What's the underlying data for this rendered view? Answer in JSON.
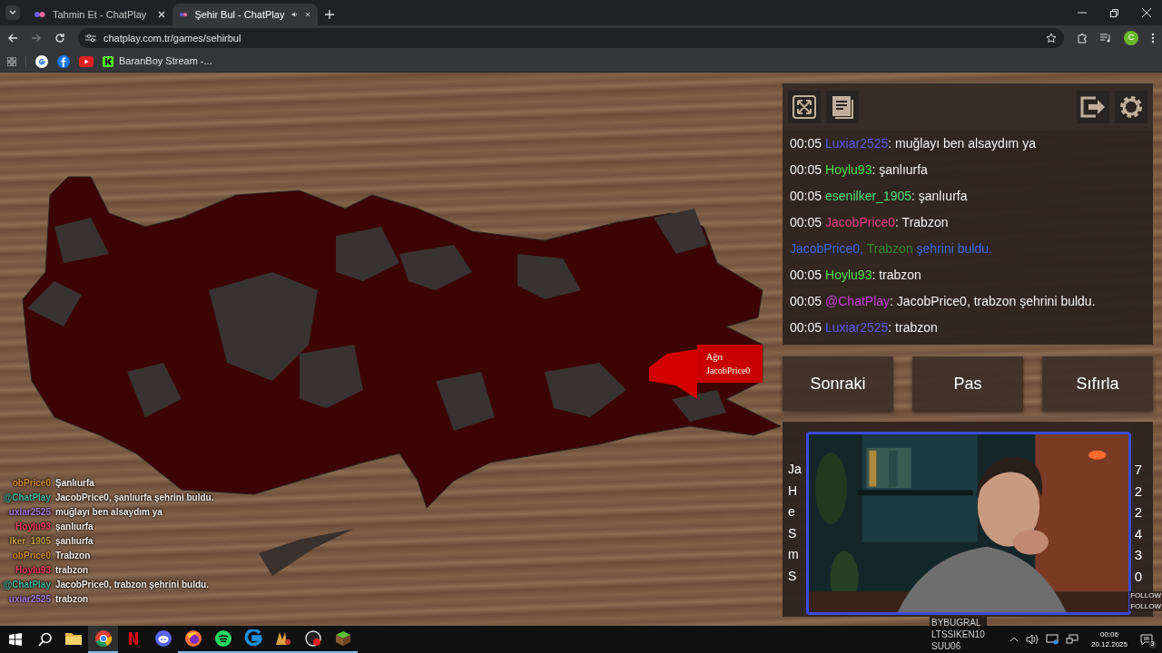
{
  "browser": {
    "tabs": [
      {
        "title": "Tahmin Et - ChatPlay",
        "selected": false,
        "audio": false
      },
      {
        "title": "Şehir Bul - ChatPlay",
        "selected": true,
        "audio": true
      }
    ],
    "url": "chatplay.com.tr/games/sehirbul",
    "profile_letter": "C",
    "bookmarks": [
      {
        "kind": "google"
      },
      {
        "kind": "facebook"
      },
      {
        "kind": "youtube"
      },
      {
        "kind": "kick",
        "label": "BaranBoy Stream -..."
      }
    ]
  },
  "map": {
    "tooltip": {
      "city": "Ağrı",
      "player": "JacobPrice0"
    }
  },
  "overlay_chat": [
    {
      "user": "obPrice0",
      "color": "#d08a2c",
      "text": "Şanlıurfa"
    },
    {
      "user": "@ChatPlay",
      "color": "#3fb8a0",
      "text": "JacobPrice0, şanlıurfa şehrini buldu."
    },
    {
      "user": "uxiar2525",
      "color": "#a478d8",
      "text": "muğlayı ben alsaydım ya"
    },
    {
      "user": "Hoylu93",
      "color": "#ff3a5a",
      "text": "şanlıurfa"
    },
    {
      "user": "lker_1905",
      "color": "#c8a040",
      "text": "şanlıurfa"
    },
    {
      "user": "obPrice0",
      "color": "#d08a2c",
      "text": "Trabzon"
    },
    {
      "user": "Hoylu93",
      "color": "#ff3a5a",
      "text": "trabzon"
    },
    {
      "user": "@ChatPlay",
      "color": "#3fb8a0",
      "text": "JacobPrice0, trabzon şehrini buldu."
    },
    {
      "user": "uxiar2525",
      "color": "#a478d8",
      "text": "trabzon"
    }
  ],
  "chat": {
    "messages": [
      {
        "kind": "message",
        "time": "00:05",
        "user": "Luxiar2525",
        "color": "#5a5ae0",
        "text": ": muğlayı ben alsaydım ya"
      },
      {
        "kind": "message",
        "time": "00:05",
        "user": "Hoylu93",
        "color": "#4ee04e",
        "text": ": şanlıurfa"
      },
      {
        "kind": "message",
        "time": "00:05",
        "user": "esenilker_1905",
        "color": "#4ee07a",
        "text": ": şanlıurfa"
      },
      {
        "kind": "message",
        "time": "00:05",
        "user": "JacobPrice0",
        "color": "#e03c8c",
        "text": ": Trabzon"
      },
      {
        "kind": "announce",
        "player": "JacobPrice0, ",
        "city": "Trabzon",
        "rest": " şehrini buldu."
      },
      {
        "kind": "message",
        "time": "00:05",
        "user": "Hoylu93",
        "color": "#4ee04e",
        "text": ": trabzon"
      },
      {
        "kind": "message",
        "time": "00:05",
        "user": "@ChatPlay",
        "color": "#c83cd8",
        "text": ": JacobPrice0, trabzon şehrini buldu."
      },
      {
        "kind": "message",
        "time": "00:05",
        "user": "Luxiar2525",
        "color": "#5a5ae0",
        "text": ": trabzon"
      }
    ]
  },
  "controls": [
    "Sonraki",
    "Pas",
    "Sıfırla"
  ],
  "leaderboard": [
    {
      "name": "Ja",
      "score": "7"
    },
    {
      "name": "H",
      "score": "2"
    },
    {
      "name": "e",
      "score": "2"
    },
    {
      "name": "S",
      "score": "4"
    },
    {
      "name": "m",
      "score": "3"
    },
    {
      "name": "S",
      "score": "0"
    }
  ],
  "stream_overlay": {
    "viewers": [
      "BYBUGRAL",
      "LTSSIKEN10",
      "SUU06"
    ],
    "follow_labels": [
      "FOLLOW",
      "FOLLOW"
    ]
  },
  "taskbar": {
    "apps": [
      {
        "kind": "explorer",
        "running": false,
        "selected": false
      },
      {
        "kind": "chrome",
        "running": true,
        "selected": true
      },
      {
        "kind": "netflix",
        "running": false,
        "selected": false
      },
      {
        "kind": "discord",
        "running": false,
        "selected": false
      },
      {
        "kind": "firefox",
        "running": true,
        "selected": false
      },
      {
        "kind": "spotify",
        "running": true,
        "selected": false
      },
      {
        "kind": "gapp",
        "running": true,
        "selected": false
      },
      {
        "kind": "game",
        "running": true,
        "selected": false
      },
      {
        "kind": "obs",
        "running": true,
        "selected": false
      },
      {
        "kind": "minecraft",
        "running": true,
        "selected": false
      }
    ],
    "time": "00:06",
    "date": "20.12.2025",
    "notifications": "3"
  }
}
